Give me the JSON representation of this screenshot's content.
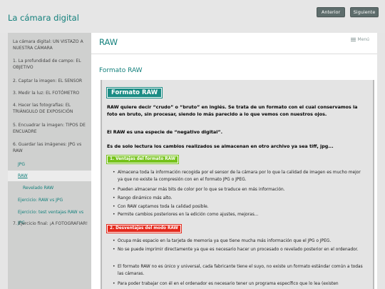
{
  "site": {
    "title": "La cámara digital"
  },
  "nav": {
    "prev_label": "Anterior",
    "next_label": "Siguiente"
  },
  "sidebar": {
    "items": [
      {
        "label": "La cámara digital: UN VISTAZO A NUESTRA CÁMARA"
      },
      {
        "label": "1. La profundidad de campo: EL OBJETIVO"
      },
      {
        "label": "2. Captar la imagen: EL SENSOR"
      },
      {
        "label": "3. Medir la luz: EL FOTÓMETRO"
      },
      {
        "label": "4. Hacer las fotografías: EL TRIÁNGULO DE EXPOSICIÓN"
      },
      {
        "label": "5. Encuadrar la imagen: TIPOS DE ENCUADRE"
      },
      {
        "label": "6. Guardar las imágenes: JPG vs RAW"
      }
    ],
    "subitems": [
      {
        "label": "JPG"
      },
      {
        "label": "RAW"
      },
      {
        "label": "Revelado RAW"
      },
      {
        "label": "Ejercicio: RAW vs JPG"
      },
      {
        "label": "Ejercicio: test ventajas RAW vs JPG"
      }
    ],
    "last_item": {
      "label": "7. Ejercicio final: ¡A FOTOGRAFIAR!"
    }
  },
  "main": {
    "page_title": "RAW",
    "menu_label": "Menú",
    "section_title": "Formato RAW",
    "article": {
      "heading": "Formato RAW",
      "para1": "RAW quiere decir “crudo” o “bruto” en inglés. Se trata de un formato con el cual conservamos la foto en bruto, sin procesar, siendo lo más parecido a lo que vemos con nuestros ojos.",
      "para2": "El RAW es una especie de “negativo digital”.",
      "para3": "Es de solo lectura los cambios realizados se almacenan en otro archivo ya sea tiff, jpg...",
      "advantages_label": "1. Ventajas del formato RAW",
      "advantages": [
        "Almacena toda la información recogida por el sensor de la cámara por lo que la calidad de imagen es mucho mejor ya que no existe la compresión con en el formato JPG o JPEG.",
        "Pueden almacenar más bits de color por lo que se traduce en más información.",
        "Rango dinámico más alto.",
        "Con RAW captamos toda la calidad posible.",
        "Permite cambios posteriores en la edición como ajustes, mejoras..."
      ],
      "disadvantages_label": "2. Desventajas del modo RAW",
      "disadvantages": [
        "Ocupa más espacio en la tarjeta de memoria ya que tiene mucha más información que el JPG o JPEG.",
        "No se puede imprimir directamente ya que es necesario hacer un procesado o revelado posterior en el ordenador.",
        "El formato RAW no es único y universal, cada fabricante tiene el suyo, no existe un formato estándar común a todas las cámaras.",
        "Para poder trabajar con él en el ordenador es necesario tener un programa específico que lo lea (existen"
      ]
    }
  }
}
